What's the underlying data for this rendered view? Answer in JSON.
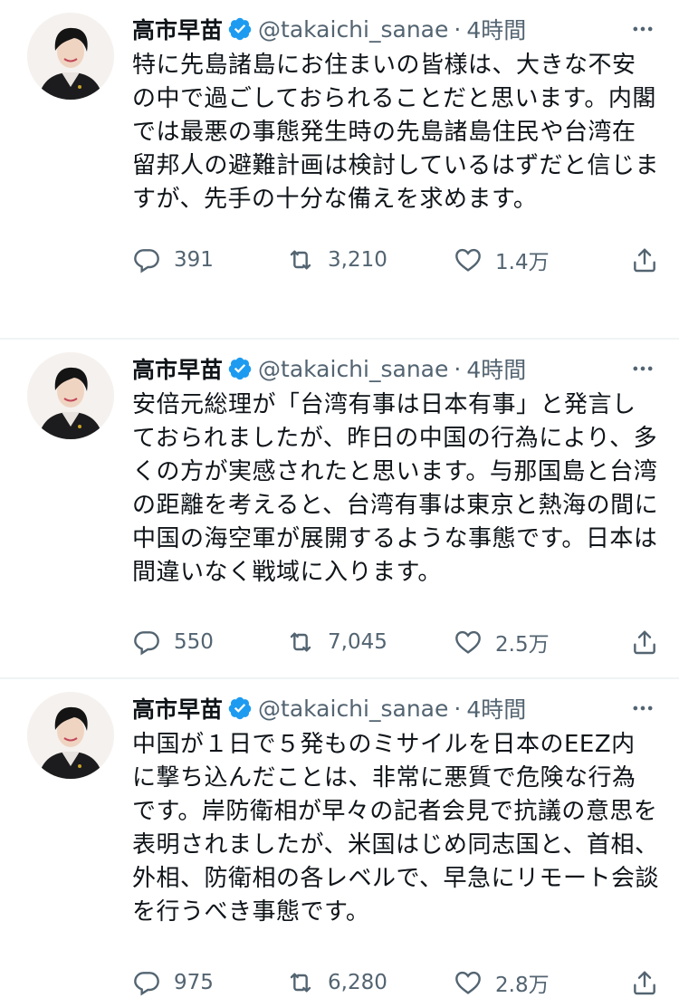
{
  "author": {
    "name": "高市早苗",
    "handle": "@takaichi_sanae",
    "separator": "·"
  },
  "colors": {
    "verified": "#1d9bf0",
    "secondary_text": "#536471",
    "divider": "#eff3f4"
  },
  "icons": {
    "verified": "verified-badge-icon",
    "more": "more-horizontal-icon",
    "reply": "reply-icon",
    "retweet": "retweet-icon",
    "like": "heart-icon",
    "share": "share-icon"
  },
  "tweets": [
    {
      "time": "4時間",
      "text": "特に先島諸島にお住まいの皆様は、大きな不安の中で過ごしておられることだと思います。内閣では最悪の事態発生時の先島諸島住民や台湾在留邦人の避難計画は検討しているはずだと信じますが、先手の十分な備えを求めます。",
      "replies": "391",
      "retweets": "3,210",
      "likes": "1.4万"
    },
    {
      "time": "4時間",
      "text": "安倍元総理が「台湾有事は日本有事」と発言しておられましたが、昨日の中国の行為により、多くの方が実感されたと思います。与那国島と台湾の距離を考えると、台湾有事は東京と熱海の間に中国の海空軍が展開するような事態です。日本は間違いなく戦域に入ります。",
      "replies": "550",
      "retweets": "7,045",
      "likes": "2.5万"
    },
    {
      "time": "4時間",
      "text": "中国が１日で５発ものミサイルを日本のEEZ内に撃ち込んだことは、非常に悪質で危険な行為です。岸防衛相が早々の記者会見で抗議の意思を表明されましたが、米国はじめ同志国と、首相、外相、防衛相の各レベルで、早急にリモート会談を行うべき事態です。",
      "replies": "975",
      "retweets": "6,280",
      "likes": "2.8万"
    }
  ]
}
